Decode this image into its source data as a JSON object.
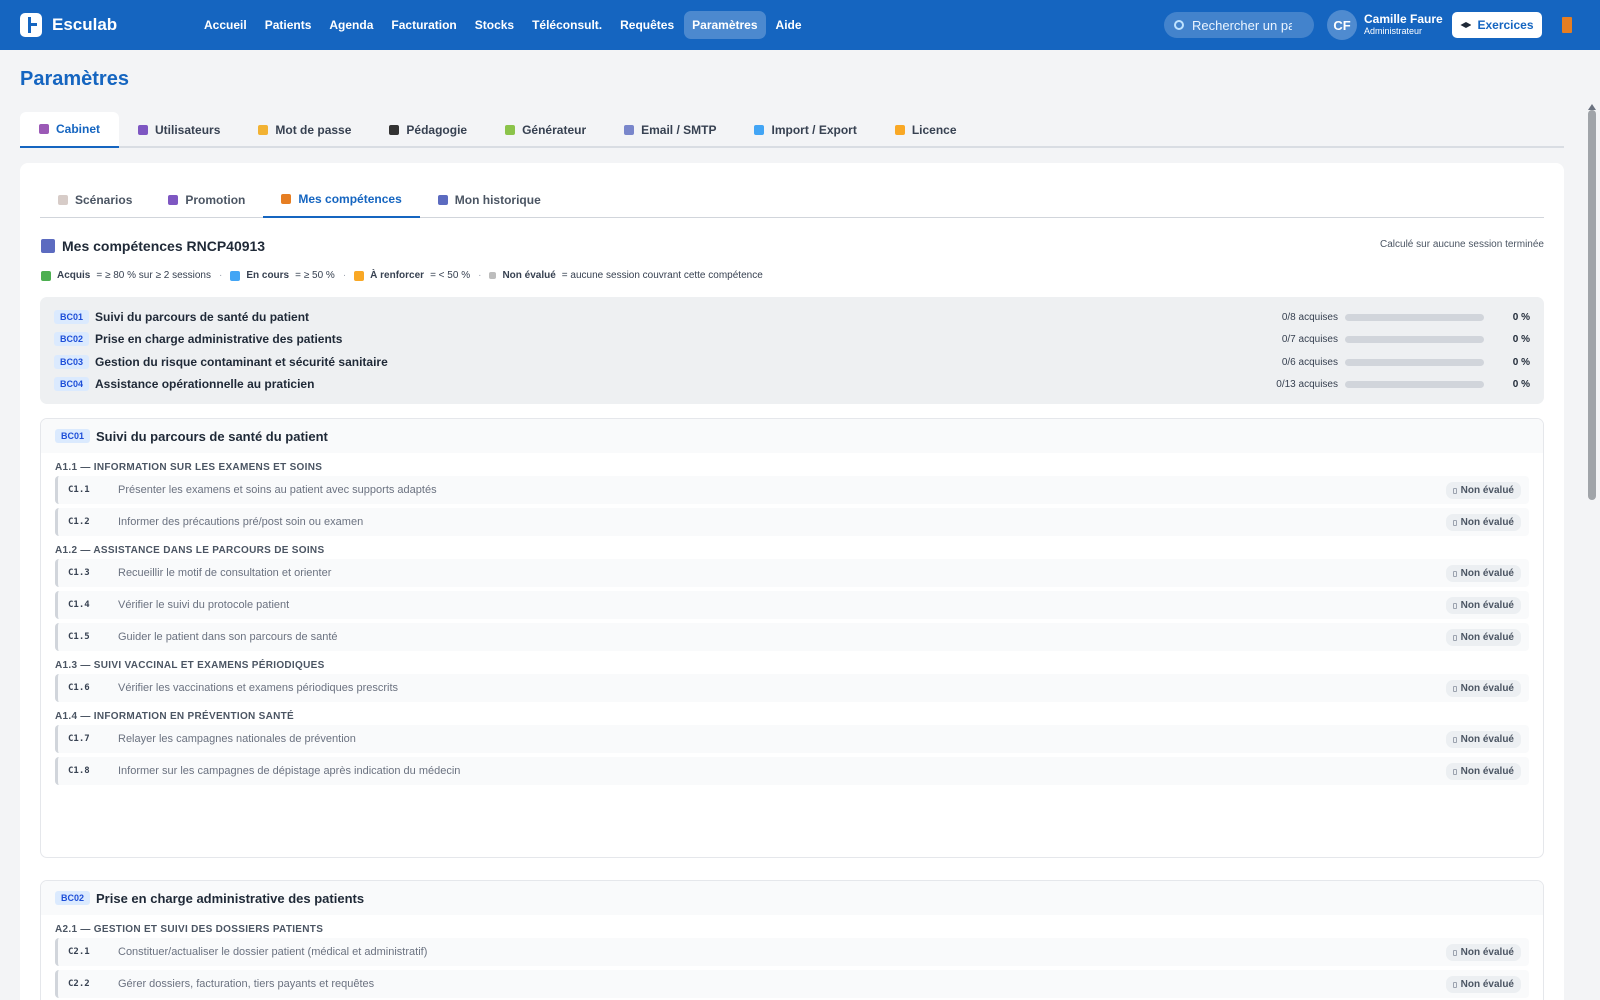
{
  "app": {
    "name": "Esculab"
  },
  "nav": [
    "Accueil",
    "Patients",
    "Agenda",
    "Facturation",
    "Stocks",
    "Téléconsult.",
    "Requêtes",
    "Paramètres",
    "Aide"
  ],
  "search": {
    "placeholder": "Rechercher un pa"
  },
  "user": {
    "initials": "CF",
    "name": "Camille Faure",
    "role": "Administrateur"
  },
  "exercises_label": "Exercices",
  "page_title": "Paramètres",
  "main_tabs": [
    "Cabinet",
    "Utilisateurs",
    "Mot de passe",
    "Pédagogie",
    "Générateur",
    "Email / SMTP",
    "Import / Export",
    "Licence"
  ],
  "sub_tabs": [
    "Scénarios",
    "Promotion",
    "Mes compétences",
    "Mon historique"
  ],
  "section": {
    "title": "Mes compétences RNCP40913",
    "calculated": "Calculé sur aucune session terminée"
  },
  "legend": {
    "acquired_label": "Acquis",
    "acquired_rule": "= ≥ 80 % sur ≥ 2 sessions",
    "inprogress_label": "En cours",
    "inprogress_rule": "= ≥ 50 %",
    "reinforce_label": "À renforcer",
    "reinforce_rule": "= < 50 %",
    "notevaluated_label": "Non évalué",
    "notevaluated_rule": "= aucune session couvrant cette compétence"
  },
  "summary": [
    {
      "code": "BC01",
      "label": "Suivi du parcours de santé du patient",
      "acquired": "0/8 acquises",
      "percent": "0 %",
      "progress": 0
    },
    {
      "code": "BC02",
      "label": "Prise en charge administrative des patients",
      "acquired": "0/7 acquises",
      "percent": "0 %",
      "progress": 0
    },
    {
      "code": "BC03",
      "label": "Gestion du risque contaminant et sécurité sanitaire",
      "acquired": "0/6 acquises",
      "percent": "0 %",
      "progress": 0
    },
    {
      "code": "BC04",
      "label": "Assistance opérationnelle au praticien",
      "acquired": "0/13 acquises",
      "percent": "0 %",
      "progress": 0
    }
  ],
  "blocks": [
    {
      "code": "BC01",
      "title": "Suivi du parcours de santé du patient",
      "groups": [
        {
          "title": "A1.1 — Information sur les examens et soins",
          "items": [
            {
              "code": "C1.1",
              "label": "Présenter les examens et soins au patient avec supports adaptés",
              "status": "Non évalué"
            },
            {
              "code": "C1.2",
              "label": "Informer des précautions pré/post soin ou examen",
              "status": "Non évalué"
            }
          ]
        },
        {
          "title": "A1.2 — Assistance dans le parcours de soins",
          "items": [
            {
              "code": "C1.3",
              "label": "Recueillir le motif de consultation et orienter",
              "status": "Non évalué"
            },
            {
              "code": "C1.4",
              "label": "Vérifier le suivi du protocole patient",
              "status": "Non évalué"
            },
            {
              "code": "C1.5",
              "label": "Guider le patient dans son parcours de santé",
              "status": "Non évalué"
            }
          ]
        },
        {
          "title": "A1.3 — Suivi vaccinal et examens périodiques",
          "items": [
            {
              "code": "C1.6",
              "label": "Vérifier les vaccinations et examens périodiques prescrits",
              "status": "Non évalué"
            }
          ]
        },
        {
          "title": "A1.4 — Information en prévention santé",
          "items": [
            {
              "code": "C1.7",
              "label": "Relayer les campagnes nationales de prévention",
              "status": "Non évalué"
            },
            {
              "code": "C1.8",
              "label": "Informer sur les campagnes de dépistage après indication du médecin",
              "status": "Non évalué"
            }
          ]
        }
      ]
    },
    {
      "code": "BC02",
      "title": "Prise en charge administrative des patients",
      "groups": [
        {
          "title": "A2.1 — Gestion et suivi des dossiers patients",
          "items": [
            {
              "code": "C2.1",
              "label": "Constituer/actualiser le dossier patient (médical et administratif)",
              "status": "Non évalué"
            },
            {
              "code": "C2.2",
              "label": "Gérer dossiers, facturation, tiers payants et requêtes",
              "status": "Non évalué"
            }
          ]
        }
      ]
    }
  ],
  "colors": {
    "primary": "#1565c0",
    "primary_light": "#dbeafe",
    "background": "#f3f4f6",
    "surface": "#ffffff"
  }
}
